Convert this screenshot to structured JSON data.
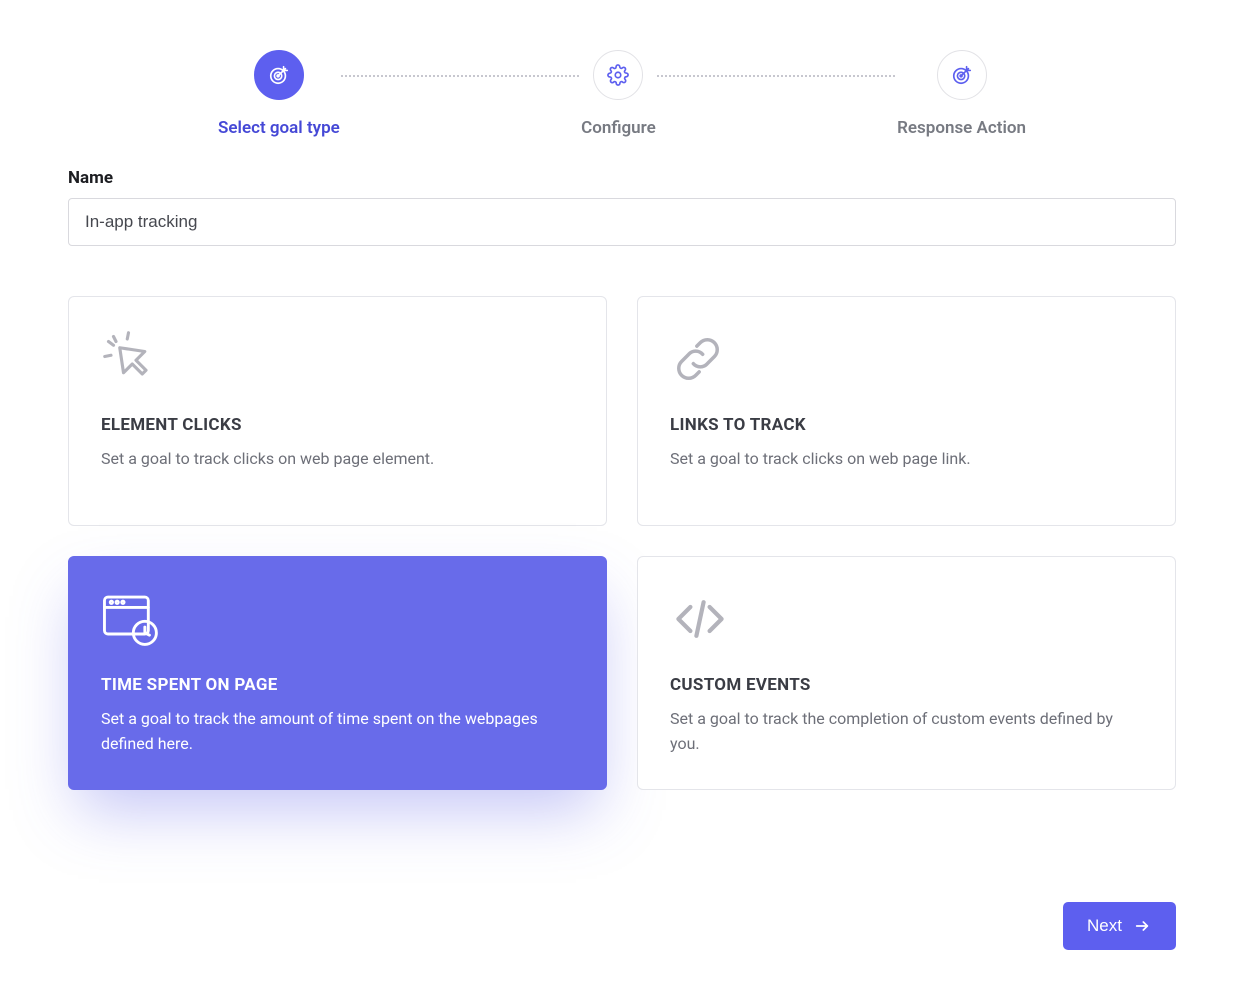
{
  "stepper": {
    "steps": [
      {
        "label": "Select goal type",
        "active": true
      },
      {
        "label": "Configure",
        "active": false
      },
      {
        "label": "Response Action",
        "active": false
      }
    ]
  },
  "form": {
    "name_label": "Name",
    "name_value": "In-app tracking"
  },
  "cards": {
    "element_clicks": {
      "title": "ELEMENT CLICKS",
      "desc": "Set a goal to track clicks on web page element."
    },
    "links_to_track": {
      "title": "LINKS TO TRACK",
      "desc": "Set a goal to track clicks on web page link."
    },
    "time_spent": {
      "title": "TIME SPENT ON PAGE",
      "desc": "Set a goal to track the amount of time spent on the webpages defined here."
    },
    "custom_events": {
      "title": "CUSTOM EVENTS",
      "desc": "Set a goal to track the completion of custom events defined by you."
    }
  },
  "footer": {
    "next_label": "Next"
  }
}
